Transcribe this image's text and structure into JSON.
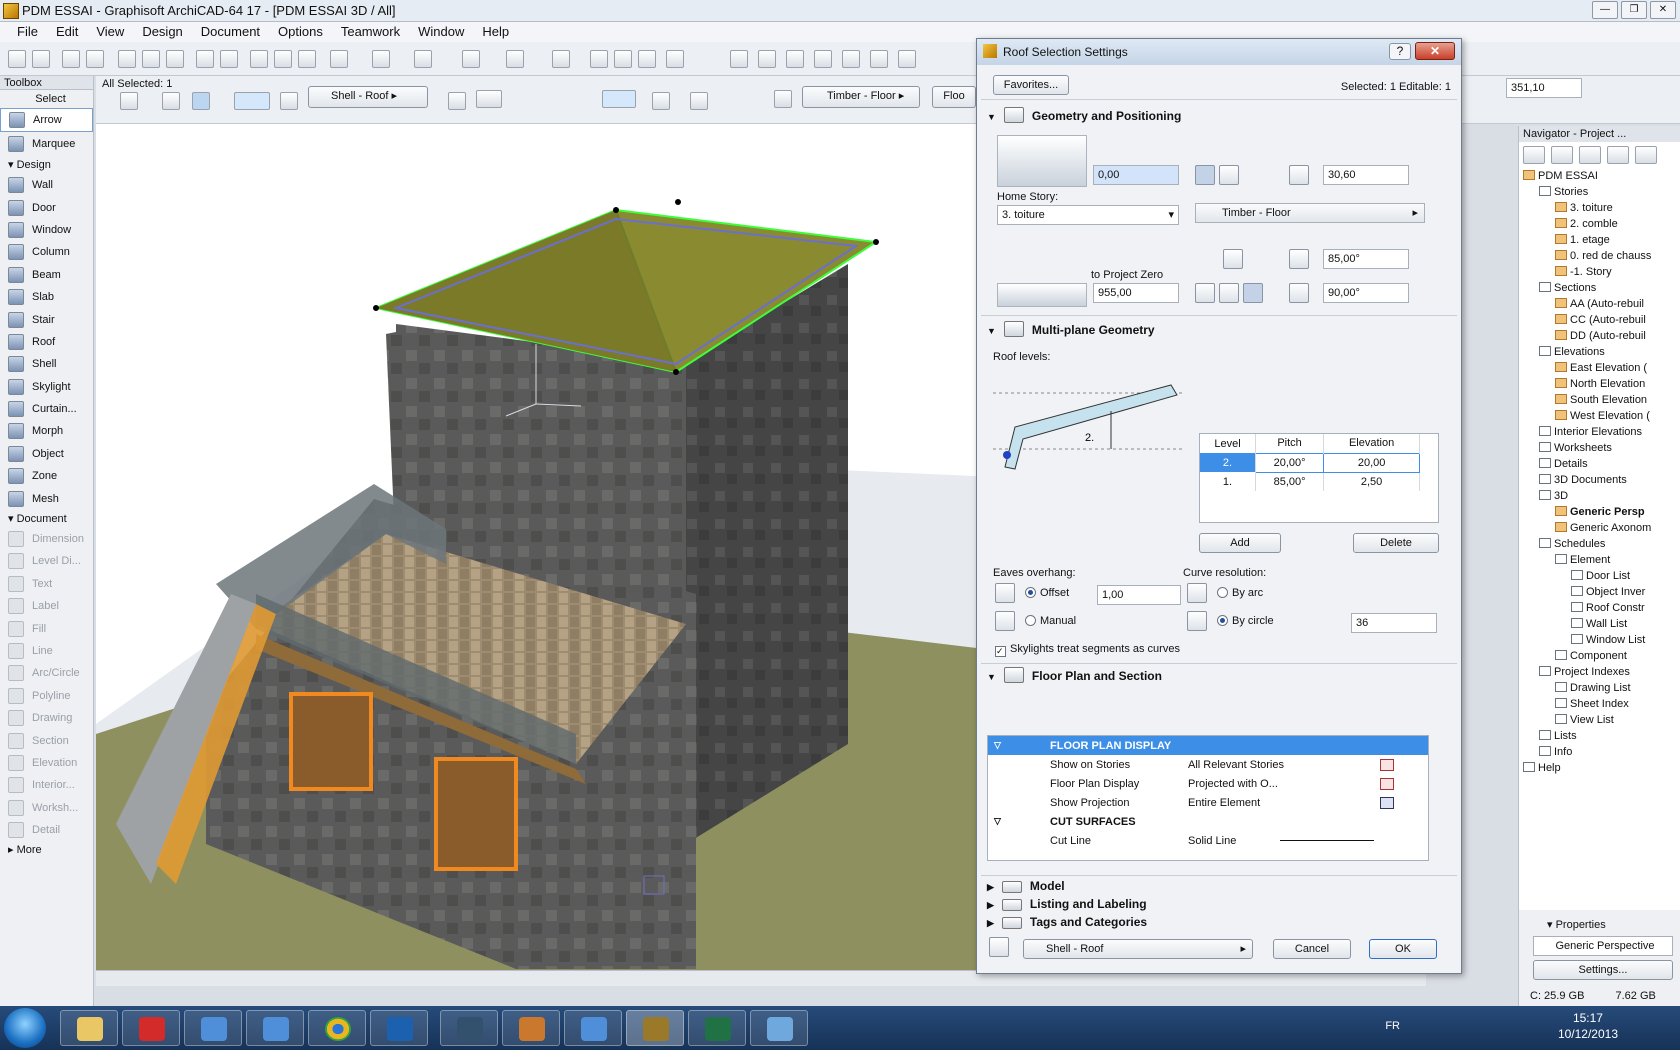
{
  "window": {
    "title": "PDM ESSAI - Graphisoft ArchiCAD-64 17 - [PDM ESSAI 3D / All]"
  },
  "menu": [
    "File",
    "Edit",
    "View",
    "Design",
    "Document",
    "Options",
    "Teamwork",
    "Window",
    "Help"
  ],
  "infobar": {
    "all_selected": "All Selected: 1",
    "layer": "Shell - Roof",
    "material": "Timber - Floor",
    "floor_short": "Floo",
    "coord": "351,10"
  },
  "toolbox": {
    "title": "Toolbox",
    "select_label": "Select",
    "select_items": [
      "Arrow",
      "Marquee"
    ],
    "design_label": "Design",
    "design_items": [
      "Wall",
      "Door",
      "Window",
      "Column",
      "Beam",
      "Slab",
      "Stair",
      "Roof",
      "Shell",
      "Skylight",
      "Curtain...",
      "Morph",
      "Object",
      "Zone",
      "Mesh"
    ],
    "document_label": "Document",
    "document_items": [
      "Dimension",
      "Level Di...",
      "Text",
      "Label",
      "Fill",
      "Line",
      "Arc/Circle",
      "Polyline",
      "Drawing",
      "Section",
      "Elevation",
      "Interior...",
      "Worksh...",
      "Detail"
    ],
    "more_label": "More"
  },
  "dialog": {
    "title": "Roof Selection Settings",
    "help": "?",
    "close": "✕",
    "favorites": "Favorites...",
    "selected_info": "Selected: 1 Editable: 1",
    "geometry": {
      "header": "Geometry and Positioning",
      "offset_value": "0,00",
      "thickness": "30,60",
      "home_story_label": "Home Story:",
      "home_story": "3. toiture",
      "material": "Timber - Floor",
      "angle1": "85,00°",
      "to_project_zero_label": "to Project Zero",
      "project_zero_value": "955,00",
      "angle2": "90,00°"
    },
    "multiplane": {
      "header": "Multi-plane Geometry",
      "roof_levels_label": "Roof levels:",
      "diagram_label": "2.",
      "columns": [
        "Level",
        "Pitch",
        "Elevation"
      ],
      "rows": [
        {
          "level": "2.",
          "pitch": "20,00°",
          "elevation": "20,00"
        },
        {
          "level": "1.",
          "pitch": "85,00°",
          "elevation": "2,50"
        }
      ],
      "add": "Add",
      "delete": "Delete",
      "eaves_label": "Eaves overhang:",
      "offset_label": "Offset",
      "offset_value": "1,00",
      "manual_label": "Manual",
      "curve_label": "Curve resolution:",
      "by_arc": "By arc",
      "by_circle": "By circle",
      "circle_value": "36",
      "skylights": "Skylights treat segments as curves"
    },
    "floorplan": {
      "header": "Floor Plan and Section",
      "group1": "FLOOR PLAN DISPLAY",
      "rows1": [
        {
          "name": "Show on Stories",
          "value": "All Relevant Stories"
        },
        {
          "name": "Floor Plan Display",
          "value": "Projected with O..."
        },
        {
          "name": "Show Projection",
          "value": "Entire Element"
        }
      ],
      "group2": "CUT SURFACES",
      "rows2": [
        {
          "name": "Cut Line",
          "value": "Solid Line"
        }
      ]
    },
    "model": "Model",
    "listing": "Listing and Labeling",
    "tags": "Tags and Categories",
    "layer": "Shell - Roof",
    "cancel": "Cancel",
    "ok": "OK"
  },
  "navigator": {
    "title": "Navigator - Project ...",
    "items": [
      {
        "t": "PDM ESSAI",
        "d": 0,
        "k": "fi"
      },
      {
        "t": "Stories",
        "d": 1,
        "k": "fb"
      },
      {
        "t": "3. toiture",
        "d": 2,
        "k": "fi"
      },
      {
        "t": "2. comble",
        "d": 2,
        "k": "fi"
      },
      {
        "t": "1. etage",
        "d": 2,
        "k": "fi"
      },
      {
        "t": "0. red de chauss",
        "d": 2,
        "k": "fi"
      },
      {
        "t": "-1. Story",
        "d": 2,
        "k": "fi"
      },
      {
        "t": "Sections",
        "d": 1,
        "k": "fb"
      },
      {
        "t": "AA (Auto-rebuil",
        "d": 2,
        "k": "fi"
      },
      {
        "t": "CC (Auto-rebuil",
        "d": 2,
        "k": "fi"
      },
      {
        "t": "DD (Auto-rebuil",
        "d": 2,
        "k": "fi"
      },
      {
        "t": "Elevations",
        "d": 1,
        "k": "fb"
      },
      {
        "t": "East Elevation (",
        "d": 2,
        "k": "fi"
      },
      {
        "t": "North Elevation",
        "d": 2,
        "k": "fi"
      },
      {
        "t": "South Elevation",
        "d": 2,
        "k": "fi"
      },
      {
        "t": "West Elevation (",
        "d": 2,
        "k": "fi"
      },
      {
        "t": "Interior Elevations",
        "d": 1,
        "k": "fb"
      },
      {
        "t": "Worksheets",
        "d": 1,
        "k": "fb"
      },
      {
        "t": "Details",
        "d": 1,
        "k": "fb"
      },
      {
        "t": "3D Documents",
        "d": 1,
        "k": "fb"
      },
      {
        "t": "3D",
        "d": 1,
        "k": "fb"
      },
      {
        "t": "Generic Persp",
        "d": 2,
        "k": "fi"
      },
      {
        "t": "Generic Axonom",
        "d": 2,
        "k": "fi"
      },
      {
        "t": "Schedules",
        "d": 1,
        "k": "fb"
      },
      {
        "t": "Element",
        "d": 2,
        "k": "fb"
      },
      {
        "t": "Door List",
        "d": 3,
        "k": "fb"
      },
      {
        "t": "Object Inver",
        "d": 3,
        "k": "fb"
      },
      {
        "t": "Roof Constr",
        "d": 3,
        "k": "fb"
      },
      {
        "t": "Wall List",
        "d": 3,
        "k": "fb"
      },
      {
        "t": "Window List",
        "d": 3,
        "k": "fb"
      },
      {
        "t": "Component",
        "d": 2,
        "k": "fb"
      },
      {
        "t": "Project Indexes",
        "d": 1,
        "k": "fb"
      },
      {
        "t": "Drawing List",
        "d": 2,
        "k": "fb"
      },
      {
        "t": "Sheet Index",
        "d": 2,
        "k": "fb"
      },
      {
        "t": "View List",
        "d": 2,
        "k": "fb"
      },
      {
        "t": "Lists",
        "d": 1,
        "k": "fb"
      },
      {
        "t": "Info",
        "d": 1,
        "k": "fb"
      },
      {
        "t": "Help",
        "d": 0,
        "k": "fb"
      }
    ],
    "properties_label": "Properties",
    "properties_value": "Generic Perspective",
    "settings": "Settings..."
  },
  "status": {
    "disk1": "C: 25.9 GB",
    "disk2": "7.62 GB",
    "lang": "FR"
  },
  "clock": {
    "time": "15:17",
    "date": "10/12/2013"
  }
}
